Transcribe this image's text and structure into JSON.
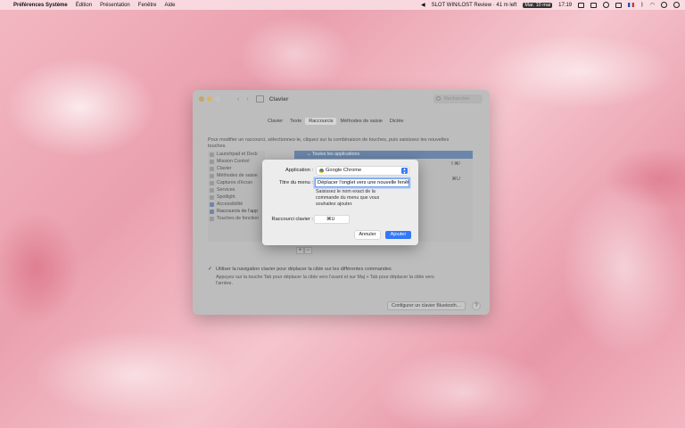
{
  "menubar": {
    "app_name": "Préférences Système",
    "menus": [
      "Édition",
      "Présentation",
      "Fenêtre",
      "Aide"
    ],
    "now_playing": "SLOT WIN/LOST Review · 41 m left",
    "date": "Mar. 10 mai",
    "time": "17:19"
  },
  "window": {
    "title": "Clavier",
    "search_placeholder": "Rechercher",
    "tabs": [
      "Clavier",
      "Texte",
      "Raccourcis",
      "Méthodes de saisie",
      "Dictée"
    ],
    "active_tab": "Raccourcis",
    "instructions": "Pour modifier un raccourci, sélectionnez-le, cliquez sur la combinaison de touches, puis saisissez les nouvelles touches.",
    "categories": [
      {
        "label": "Launchpad et Dock",
        "icon": "launchpad-icon"
      },
      {
        "label": "Mission Control",
        "icon": "mission-control-icon"
      },
      {
        "label": "Clavier",
        "icon": "keyboard-icon"
      },
      {
        "label": "Méthodes de saisie",
        "icon": "input-sources-icon"
      },
      {
        "label": "Captures d'écran",
        "icon": "screenshot-icon"
      },
      {
        "label": "Services",
        "icon": "services-icon"
      },
      {
        "label": "Spotlight",
        "icon": "spotlight-icon"
      },
      {
        "label": "Accessibilité",
        "icon": "accessibility-icon"
      },
      {
        "label": "Raccourcis de l'app",
        "icon": "app-shortcuts-icon"
      },
      {
        "label": "Touches de fonction",
        "icon": "function-keys-icon"
      }
    ],
    "selected_app_row": "Toutes les applications",
    "shortcut_1": "⇧⌘/",
    "shortcut_2": "⌘U",
    "plus": "+",
    "minus": "−",
    "checkbox_label": "Utiliser la navigation clavier pour déplacer la cible sur les différentes commandes",
    "note": "Appuyez sur la touche Tab pour déplacer la cible vers l'avant et sur Maj + Tab pour déplacer la cible vers l'arrière.",
    "bluetooth_button": "Configurer un clavier Bluetooth…",
    "help": "?"
  },
  "dialog": {
    "app_label": "Application :",
    "app_value": "Google Chrome",
    "menu_title_label": "Titre du menu :",
    "menu_title_value": "Déplacer l'onglet vers une nouvelle fenêtre",
    "hint": "Saisissez le nom exact de la commande du menu que vous souhaitez ajouter.",
    "shortcut_label": "Raccourci clavier :",
    "shortcut_value": "⌘U",
    "cancel": "Annuler",
    "add": "Ajouter"
  }
}
